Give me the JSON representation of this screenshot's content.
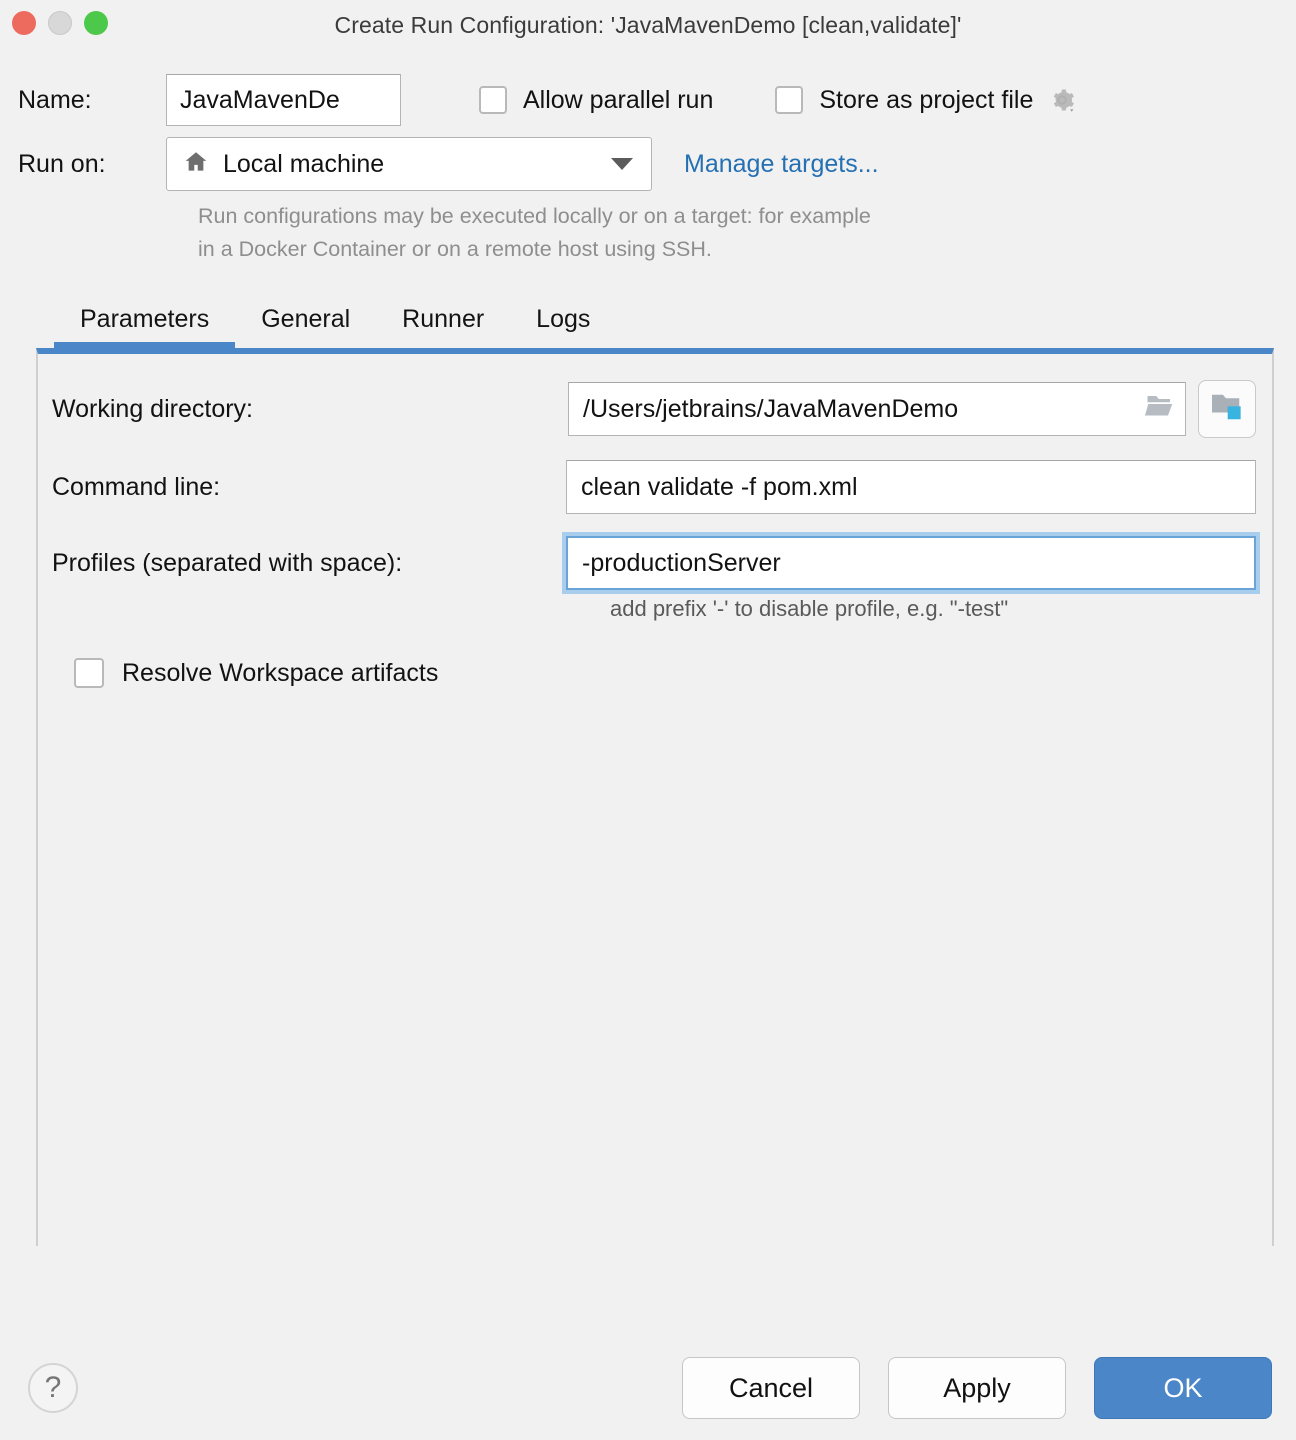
{
  "window": {
    "title": "Create Run Configuration: 'JavaMavenDemo [clean,validate]'",
    "traffic_lights": [
      "close-red",
      "minimize-gray",
      "zoom-green"
    ],
    "colors": {
      "accent": "#4a86c8",
      "link": "#2470b3",
      "close": "#ec6a5e",
      "minimize": "#d8d8d8",
      "zoom": "#4cc84a",
      "focus_ring": "#a9cdec",
      "background": "#f1f1f1"
    }
  },
  "form": {
    "name": {
      "label": "Name:",
      "value": "JavaMavenDe",
      "placeholder": "Name"
    },
    "allow_parallel_run": {
      "label": "Allow parallel run",
      "checked": false
    },
    "store_as_project_file": {
      "label": "Store as project file",
      "checked": false,
      "gear_icon": "gear-icon"
    },
    "run_on": {
      "label": "Run on:",
      "selected": "Local machine",
      "icon": "home-icon",
      "options": [
        "Local machine"
      ]
    },
    "manage_targets_link": "Manage targets...",
    "description_lines": [
      "Run configurations may be executed locally or on a target: for example",
      "in a Docker Container or on a remote host using SSH."
    ]
  },
  "tabs": [
    {
      "label": "Parameters",
      "active": true
    },
    {
      "label": "General",
      "active": false
    },
    {
      "label": "Runner",
      "active": false
    },
    {
      "label": "Logs",
      "active": false
    }
  ],
  "parameters": {
    "working_directory": {
      "label": "Working directory:",
      "value": "/Users/jetbrains/JavaMavenDemo",
      "placeholder": "Working directory",
      "inline_icon": "folder-open-icon",
      "browse_button_icon": "module-folder-icon"
    },
    "command_line": {
      "label": "Command line:",
      "value": "clean validate -f pom.xml",
      "placeholder": "Command line"
    },
    "profiles": {
      "label": "Profiles (separated with space):",
      "value": "-productionServer",
      "placeholder": "Profiles",
      "focused": true,
      "hint": "add prefix '-' to disable profile, e.g. \"-test\""
    },
    "resolve_workspace_artifacts": {
      "label": "Resolve Workspace artifacts",
      "checked": false
    }
  },
  "footer": {
    "help_label": "?",
    "cancel_label": "Cancel",
    "apply_label": "Apply",
    "ok_label": "OK"
  }
}
